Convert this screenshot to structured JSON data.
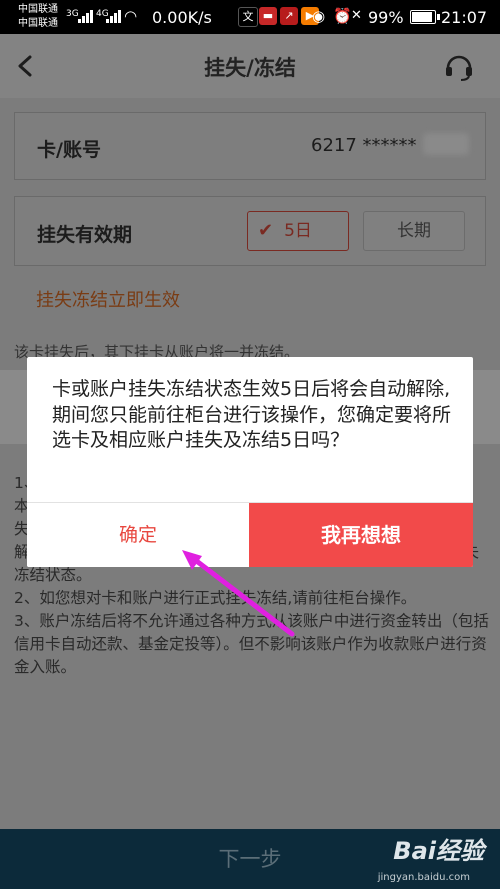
{
  "status_bar": {
    "carrier_1": "中国联通",
    "carrier_2": "中国联通",
    "net_1": "3G",
    "net_2": "4G",
    "net_speed": "0.00K/s",
    "battery": "99%",
    "battery_level": 0.99,
    "time": "21:07"
  },
  "header": {
    "title": "挂失/冻结",
    "back_icon": "chevron-left-icon",
    "service_icon": "headset-icon"
  },
  "card_row": {
    "label": "卡/账号",
    "value": "6217 ******"
  },
  "period_row": {
    "label": "挂失有效期",
    "options": [
      "5日",
      "长期"
    ],
    "selected": "5日"
  },
  "immediate_note": "挂失冻结立即生效",
  "sub_note": "该卡挂失后，其下挂卡从账户将一并冻结。",
  "notes": [
    "1、",
    "本",
    "失",
    "解除；如您选择的有效期为长期，则您需要前往柜台才能解除其挂失冻结状态。",
    "2、如您想对卡和账户进行正式挂失冻结,请前往柜台操作。",
    "3、账户冻结后将不允许通过各种方式从该账户中进行资金转出（包括信用卡自动还款、基金定投等）。但不影响该账户作为收款账户进行资金入账。"
  ],
  "next_button": "下一步",
  "dialog": {
    "message": "卡或账户挂失冻结状态生效5日后将会自动解除, 期间您只能前往柜台进行该操作，您确定要将所选卡及相应账户挂失及冻结5日吗？",
    "confirm": "确定",
    "cancel": "我再想想"
  },
  "watermark": {
    "brand": "Bai经验",
    "url": "jingyan.baidu.com"
  },
  "colors": {
    "accent_red": "#f24a4a",
    "confirm_text": "#e8473f",
    "overlay": "#7c7c7c",
    "annotation_arrow": "#e020e0"
  }
}
